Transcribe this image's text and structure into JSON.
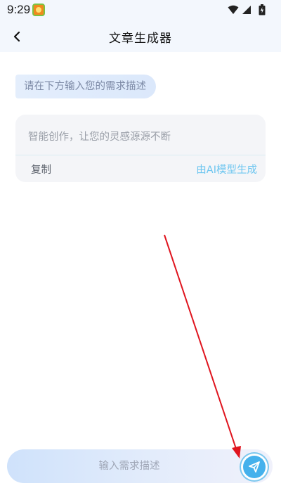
{
  "status_bar": {
    "time": "9:29",
    "icons": [
      "app-badge-icon",
      "wifi-icon",
      "signal-icon",
      "battery-icon"
    ]
  },
  "header": {
    "title": "文章生成器",
    "back_icon": "chevron-left-icon"
  },
  "hint": {
    "text": "请在下方输入您的需求描述"
  },
  "card": {
    "placeholder": "智能创作，让您的灵感源源不断",
    "copy_label": "复制",
    "ai_note": "由AI模型生成"
  },
  "input": {
    "placeholder": "输入需求描述",
    "value": ""
  },
  "send": {
    "icon": "send-icon"
  },
  "colors": {
    "accent": "#45b1ec",
    "ai_note": "#6ec6f0",
    "annotation": "#e0141e",
    "header_bg": "#f3f7fd"
  }
}
